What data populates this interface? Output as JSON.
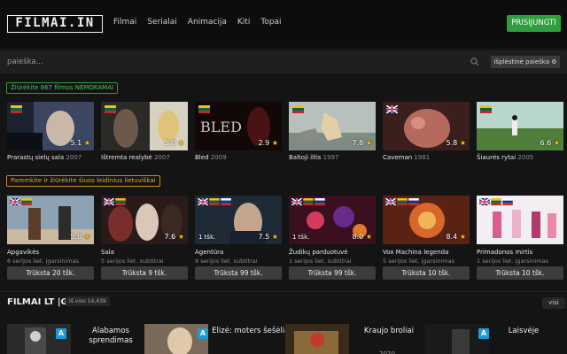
{
  "header": {
    "logo": "FILMAI.IN",
    "nav": [
      "Filmai",
      "Serialai",
      "Animacija",
      "Kiti",
      "Topai"
    ],
    "login_label": "PRISIJUNGTI"
  },
  "search": {
    "placeholder": "paieška...",
    "advanced_label": "Išplėstinė paieška ⚙"
  },
  "free_badge": "Žiūrėkite 867 filmus NEMOKAMAI",
  "support_badge": "Paremkite ir žiūrėkite šiuos leidinius lietuviškai",
  "free_movies": [
    {
      "title": "Prarastų sielų sala",
      "year": "2007",
      "rating": "5.1",
      "flag": "lt"
    },
    {
      "title": "Ištremta realybė",
      "year": "2007",
      "rating": "5.0",
      "flag": "lt"
    },
    {
      "title": "Bled",
      "year": "2009",
      "rating": "2.9",
      "flag": "lt"
    },
    {
      "title": "Baltoji iltis",
      "year": "1997",
      "rating": "7.8",
      "flag": "lt"
    },
    {
      "title": "Caveman",
      "year": "1981",
      "rating": "5.8",
      "flag": "gb"
    },
    {
      "title": "Šiaurės rytai",
      "year": "2005",
      "rating": "6.6",
      "flag": "lt"
    }
  ],
  "support_movies": [
    {
      "title": "Apgavikės",
      "sub": "6 serijos liet. įgarsinimas",
      "tsk": "",
      "rating": "5.8",
      "need": "Trūksta 20 tšk.",
      "flags": [
        "gb",
        "lt"
      ]
    },
    {
      "title": "Sala",
      "sub": "5 serijos liet. subtitrai",
      "tsk": "",
      "rating": "7.6",
      "need": "Trūksta 9 tšk.",
      "flags": [
        "gb",
        "lt"
      ]
    },
    {
      "title": "Agentūra",
      "sub": "9 serijos liet. subtitrai",
      "tsk": "1 tšk.",
      "rating": "7.5",
      "need": "Trūksta 99 tšk.",
      "flags": [
        "gb",
        "lt",
        "ru"
      ]
    },
    {
      "title": "Žudikų parduotuvė",
      "sub": "1 serijos liet. subtitrai",
      "tsk": "1 tšk.",
      "rating": "8.0",
      "need": "Trūksta 99 tšk.",
      "flags": [
        "gb",
        "lt",
        "ru"
      ]
    },
    {
      "title": "Vox Machina legenda",
      "sub": "5 serijos liet. įgarsinimas",
      "tsk": "",
      "rating": "8.4",
      "need": "Trūksta 10 tšk.",
      "flags": [
        "gb",
        "lt",
        "ru"
      ]
    },
    {
      "title": "Primadonos mirtis",
      "sub": "1 serijos liet. įgarsinimas",
      "tsk": "",
      "rating": "",
      "need": "Trūksta 10 tšk.",
      "flags": [
        "gb",
        "lt",
        "ru"
      ]
    }
  ],
  "section": {
    "title": "FILMAI LT |G.",
    "count": "Iš viso 14,439",
    "all_label": "visi"
  },
  "list_items": [
    {
      "title": "Alabamos sprendimas",
      "year": ""
    },
    {
      "title": "Elizė: moters šešėliai",
      "year": ""
    },
    {
      "title": "Kraujo broliai",
      "year": "2020"
    },
    {
      "title": "Laisvėje",
      "year": ""
    }
  ],
  "colors": {
    "accent_green": "#2e9e3e",
    "accent_orange": "#c98b22",
    "badge_blue": "#1e9ad6",
    "star": "#f2c40e"
  }
}
